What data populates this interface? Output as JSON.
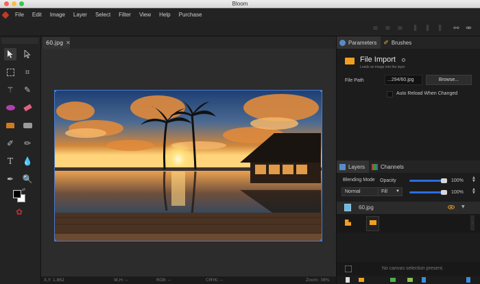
{
  "window": {
    "title": "Bloom"
  },
  "menu": [
    "File",
    "Edit",
    "Image",
    "Layer",
    "Select",
    "Filter",
    "View",
    "Help",
    "Purchase"
  ],
  "document": {
    "tab_label": "60.jpg",
    "close_glyph": "✕"
  },
  "status": {
    "coords": "X,Y: 1,862",
    "wh": "W,H: --",
    "rgb": "RGB: --",
    "cmyk": "CMYK: --",
    "zoom": "Zoom: 38%"
  },
  "params_panel": {
    "tabs": [
      "Parameters",
      "Brushes"
    ],
    "title": "File Import",
    "subtitle": "Loads an image into the layer",
    "file_path_label": "File Path",
    "file_path_value": "...294/60.jpg",
    "browse_label": "Browse...",
    "auto_reload_label": "Auto Reload When Changed"
  },
  "layers_panel": {
    "tabs": [
      "Layers",
      "Channels"
    ],
    "blending_mode_label": "Blending Mode",
    "blending_mode_value": "Normal",
    "opacity_label": "Opacity",
    "opacity_value": "100%",
    "fill_label": "Fill",
    "fill_value": "100%",
    "opacity_level": 1.0,
    "fill_level": 1.0,
    "layer_name": "60.jpg",
    "no_selection_text": "No canvas selection present."
  },
  "colors": {
    "accent": "#2d6de0",
    "selection_border": "#4a7bd0",
    "folder": "#f0a020"
  }
}
